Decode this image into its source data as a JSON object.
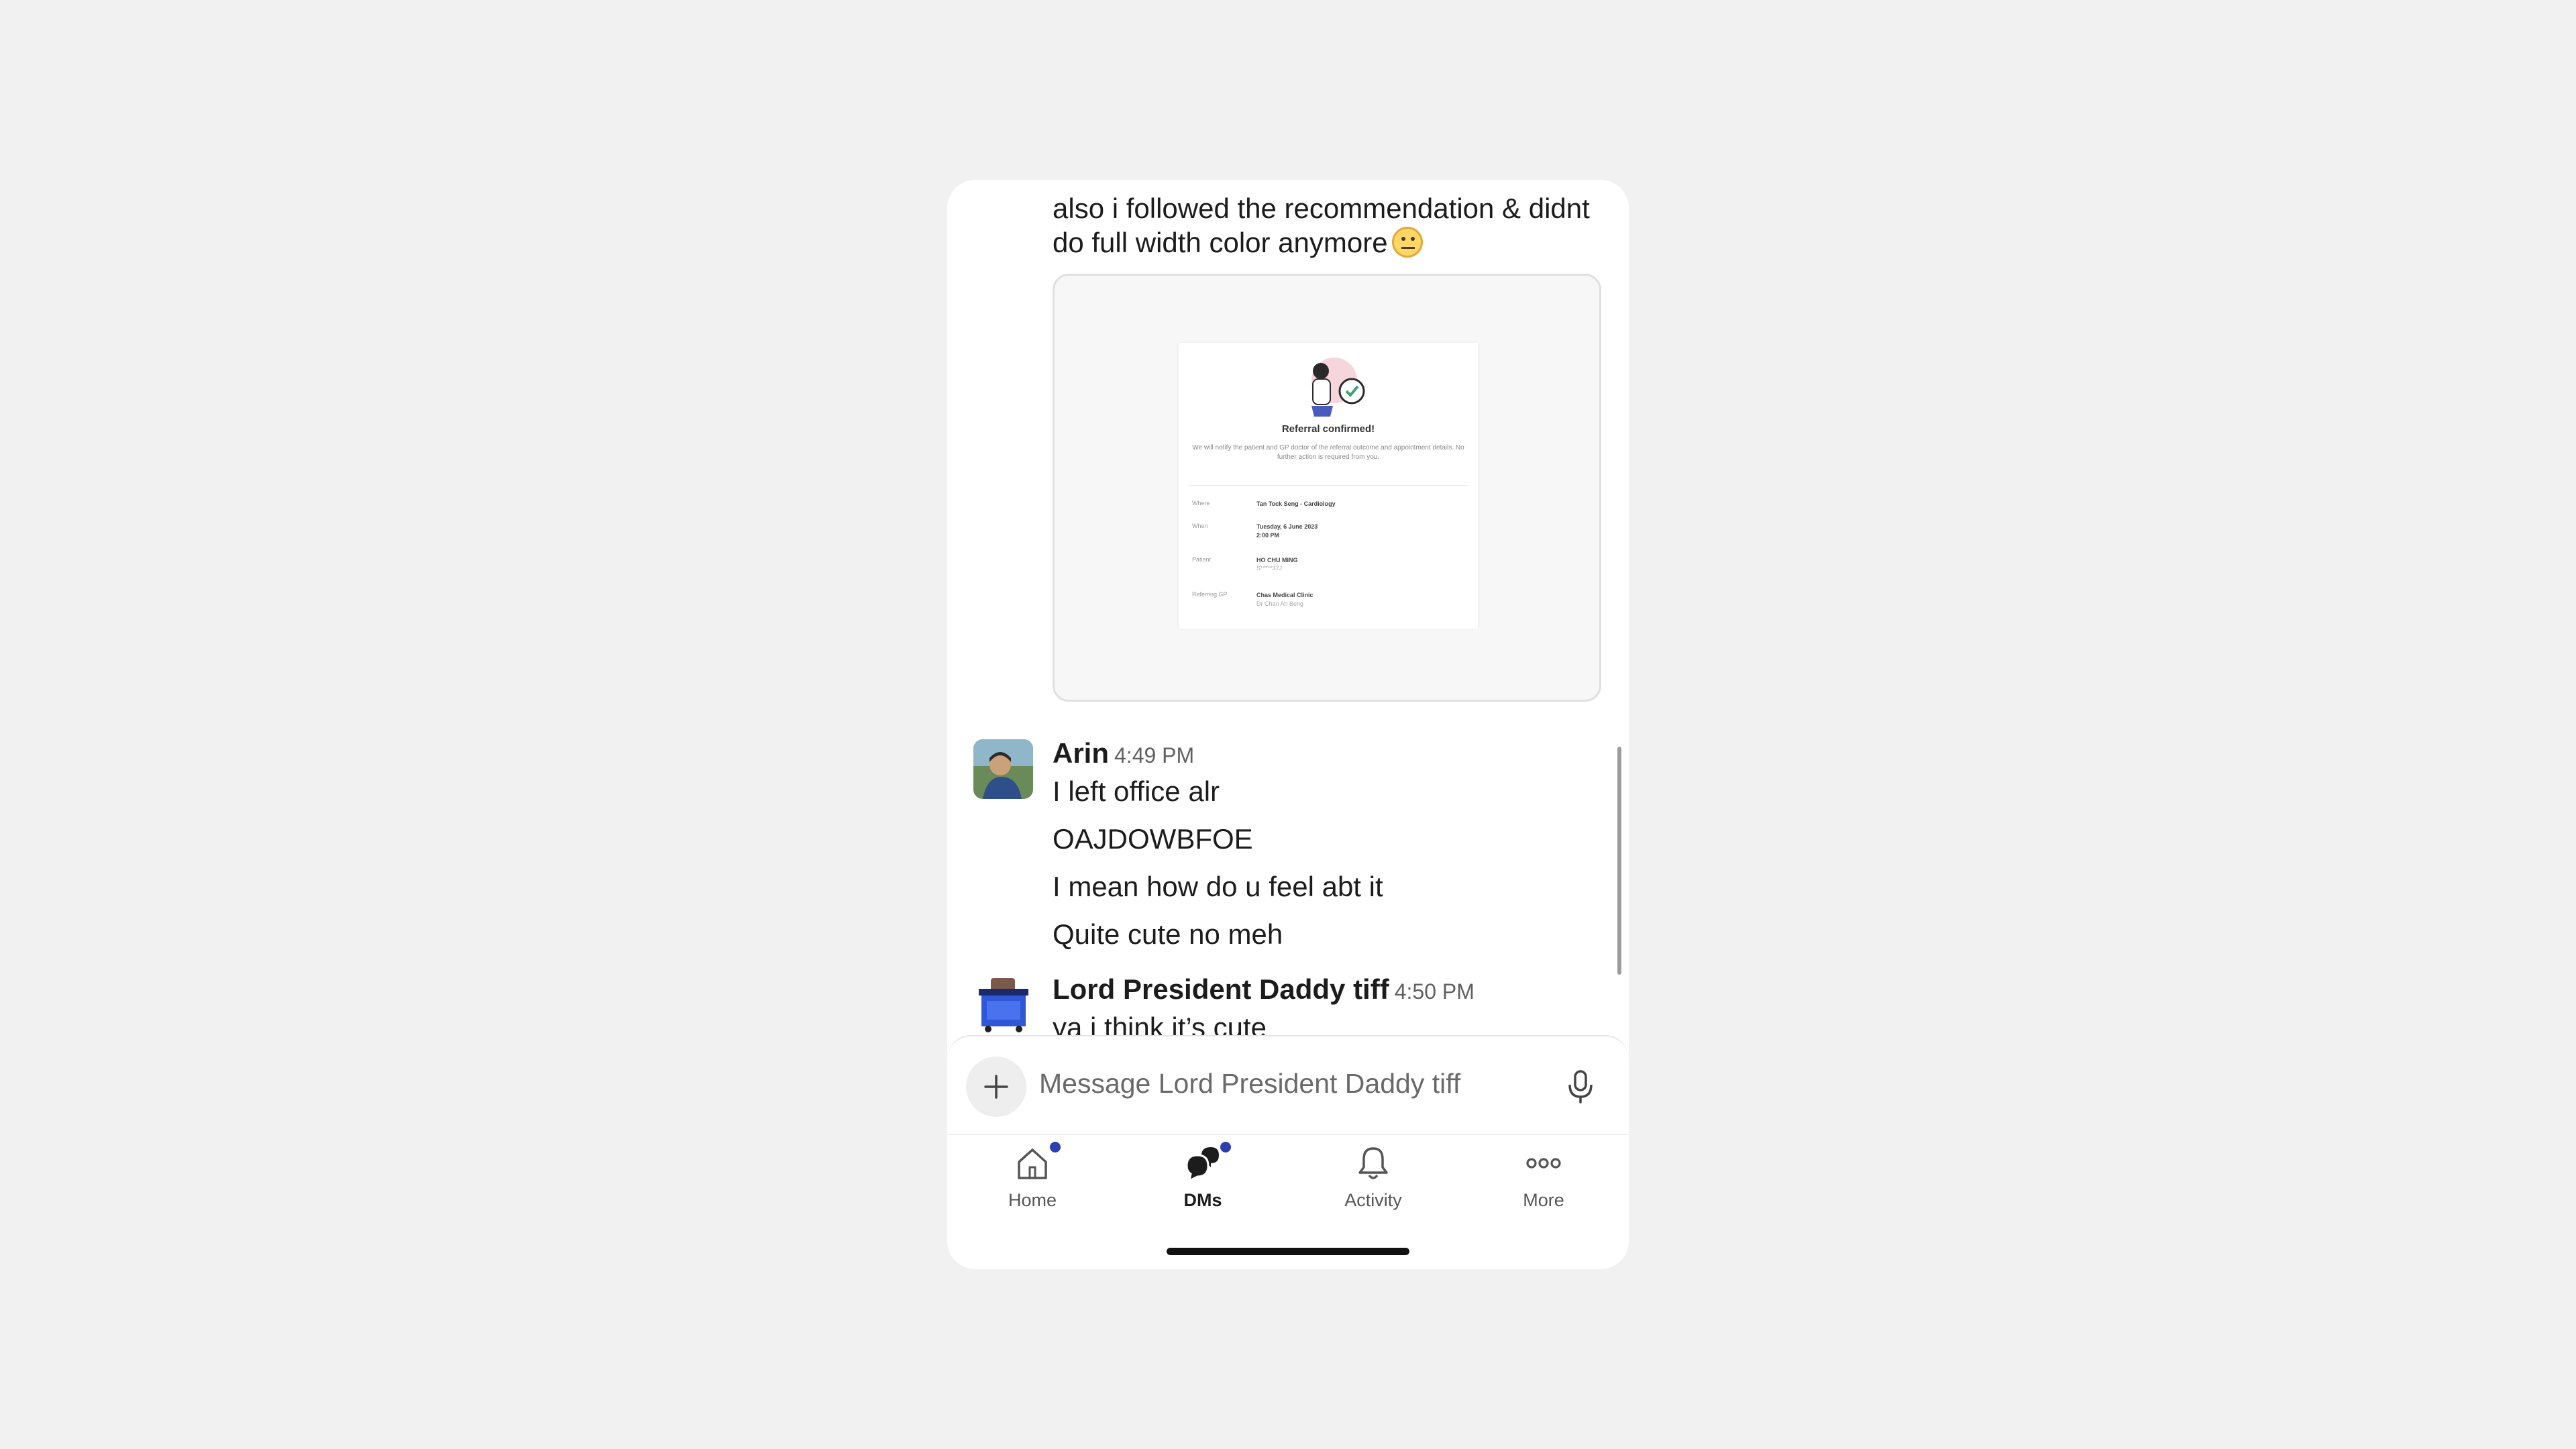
{
  "messages": {
    "prev_text": "also i followed the recommendation & didnt do full width color anymore",
    "prev_emoji": "neutral-face-emoji",
    "attachment": {
      "title": "Referral confirmed!",
      "description": "We will notify the patient and GP doctor of the referral outcome and appointment details. No further action is required from you.",
      "rows": [
        {
          "label": "Where",
          "value": "Tan Tock Seng - Cardiology",
          "sub": ""
        },
        {
          "label": "When",
          "value": "Tuesday, 6 June 2023",
          "value2": "2:00 PM",
          "sub": ""
        },
        {
          "label": "Patient",
          "value": "HO CHU MING",
          "sub": "S*****37J"
        },
        {
          "label": "Referring GP",
          "value": "Chas Medical Clinic",
          "sub": "Dr Chan Ah Beng"
        }
      ]
    },
    "arin": {
      "name": "Arin",
      "time": "4:49 PM",
      "lines": [
        "I left office alr",
        "OAJDOWBFOE",
        "I mean how do u feel abt it",
        "Quite cute no meh"
      ]
    },
    "tiff": {
      "name": "Lord President Daddy tiff",
      "time": "4:50 PM",
      "line": "ya i think it’s cute"
    }
  },
  "composer": {
    "placeholder": "Message Lord President Daddy tiff"
  },
  "tabs": [
    {
      "label": "Home",
      "icon": "home-icon",
      "badge": true
    },
    {
      "label": "DMs",
      "icon": "dms-icon",
      "badge": true,
      "active": true
    },
    {
      "label": "Activity",
      "icon": "bell-icon",
      "badge": false
    },
    {
      "label": "More",
      "icon": "more-icon",
      "badge": false
    }
  ],
  "colors": {
    "badge": "#2b3fb0",
    "background": "#f1f1f1",
    "text": "#1d1c1d"
  }
}
